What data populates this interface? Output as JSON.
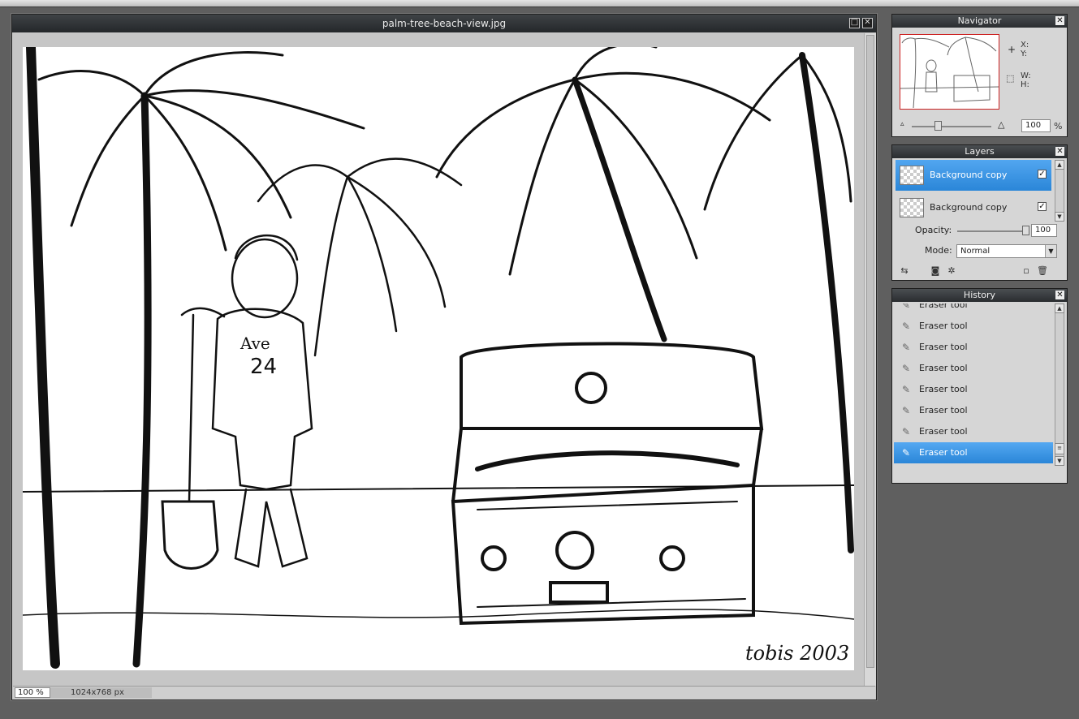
{
  "document": {
    "title": "palm-tree-beach-view.jpg",
    "zoom": "100 %",
    "dimensions": "1024x768 px",
    "signature": "tobis 2003"
  },
  "navigator": {
    "title": "Navigator",
    "x_label": "X:",
    "y_label": "Y:",
    "w_label": "W:",
    "h_label": "H:",
    "zoom_value": "100",
    "zoom_unit": "%"
  },
  "layers": {
    "title": "Layers",
    "items": [
      {
        "name": "Background copy",
        "visible": true,
        "selected": true
      },
      {
        "name": "Background copy",
        "visible": true,
        "selected": false
      }
    ],
    "opacity_label": "Opacity:",
    "opacity_value": "100",
    "mode_label": "Mode:",
    "mode_value": "Normal"
  },
  "history": {
    "title": "History",
    "items": [
      {
        "label": "Eraser tool",
        "selected": false
      },
      {
        "label": "Eraser tool",
        "selected": false
      },
      {
        "label": "Eraser tool",
        "selected": false
      },
      {
        "label": "Eraser tool",
        "selected": false
      },
      {
        "label": "Eraser tool",
        "selected": false
      },
      {
        "label": "Eraser tool",
        "selected": false
      },
      {
        "label": "Eraser tool",
        "selected": false
      },
      {
        "label": "Eraser tool",
        "selected": true
      }
    ]
  },
  "icons": {
    "close": "close-icon",
    "maximize": "maximize-icon",
    "eraser": "eraser-icon",
    "crosshair": "crosshair-icon",
    "selection-size": "selection-size-icon",
    "zoom-out": "zoom-out-icon",
    "zoom-in": "zoom-in-icon"
  },
  "colors": {
    "selection_blue": "#2a86d8",
    "title_bar": "#2a2d30",
    "navigator_frame": "#cc2222",
    "workspace": "#5f5f5f"
  }
}
